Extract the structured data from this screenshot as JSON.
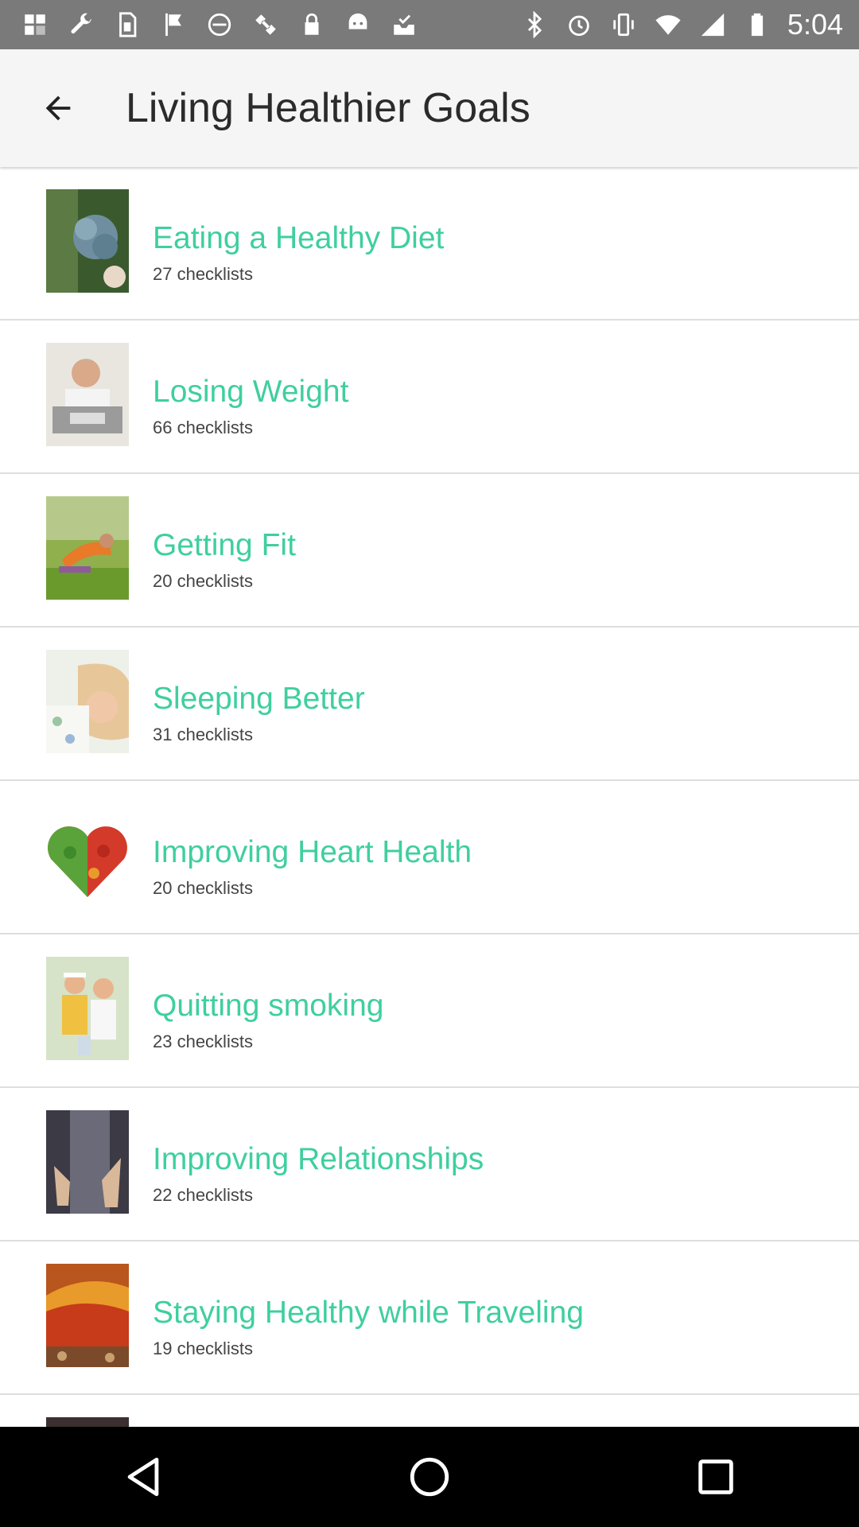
{
  "status_bar": {
    "time": "5:04",
    "left_icons": [
      "notification-icon",
      "wrench-icon",
      "sim-icon",
      "flag-icon",
      "blocked-icon",
      "satellite-icon",
      "lock-icon",
      "android-icon",
      "inbox-check-icon"
    ],
    "right_icons": [
      "bluetooth-icon",
      "alarm-icon",
      "vibrate-icon",
      "wifi-icon",
      "signal-icon",
      "battery-icon"
    ]
  },
  "header": {
    "title": "Living Healthier Goals",
    "back_icon": "back-arrow-icon"
  },
  "goals": [
    {
      "title": "Eating a Healthy Diet",
      "count": "27 checklists"
    },
    {
      "title": "Losing Weight",
      "count": "66 checklists"
    },
    {
      "title": "Getting Fit",
      "count": "20 checklists"
    },
    {
      "title": "Sleeping Better",
      "count": "31 checklists"
    },
    {
      "title": "Improving Heart Health",
      "count": "20 checklists"
    },
    {
      "title": "Quitting smoking",
      "count": "23 checklists"
    },
    {
      "title": "Improving Relationships",
      "count": "22 checklists"
    },
    {
      "title": "Staying Healthy while Traveling",
      "count": "19 checklists"
    }
  ],
  "nav_bar": {
    "icons": [
      "nav-back-icon",
      "nav-home-icon",
      "nav-recents-icon"
    ]
  },
  "colors": {
    "accent": "#3fcf9e",
    "status_bar": "#7a7a7a",
    "app_bar": "#f5f5f5"
  }
}
